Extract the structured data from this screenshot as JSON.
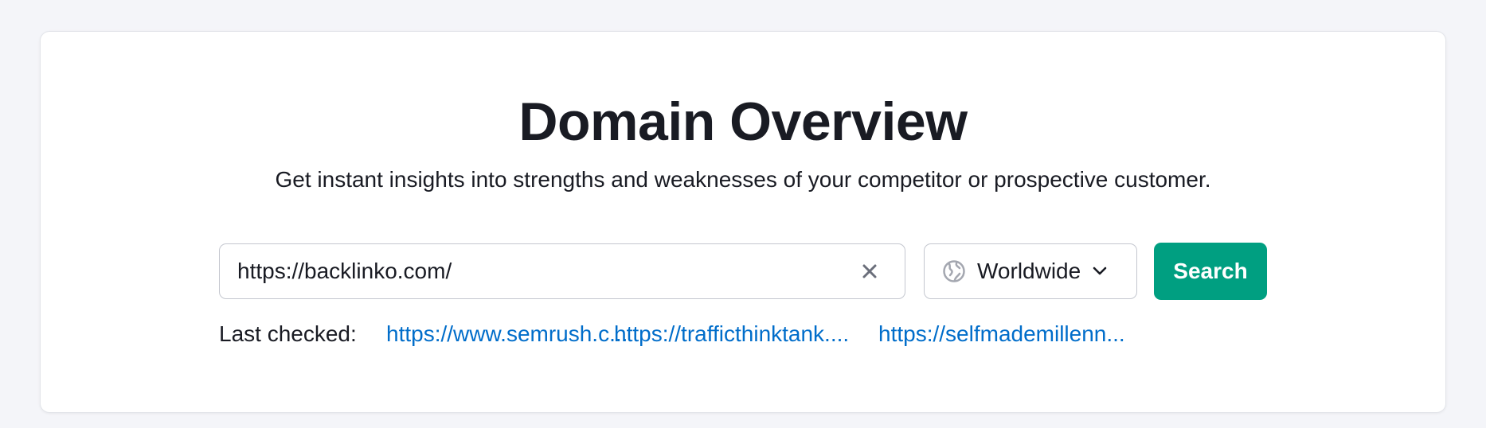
{
  "header": {
    "title": "Domain Overview",
    "subtitle": "Get instant insights into strengths and weaknesses of your competitor or prospective customer."
  },
  "search": {
    "value": "https://backlinko.com/",
    "clear_icon": "close-icon",
    "region": "Worldwide",
    "region_icon": "globe-icon",
    "button_label": "Search"
  },
  "last_checked": {
    "label": "Last checked:",
    "links": [
      "https://www.semrush.c...",
      "https://trafficthinktank....",
      "https://selfmademillenn..."
    ]
  },
  "colors": {
    "accent": "#009f81",
    "link": "#006dca",
    "text": "#191b23",
    "background": "#f4f5f9"
  }
}
